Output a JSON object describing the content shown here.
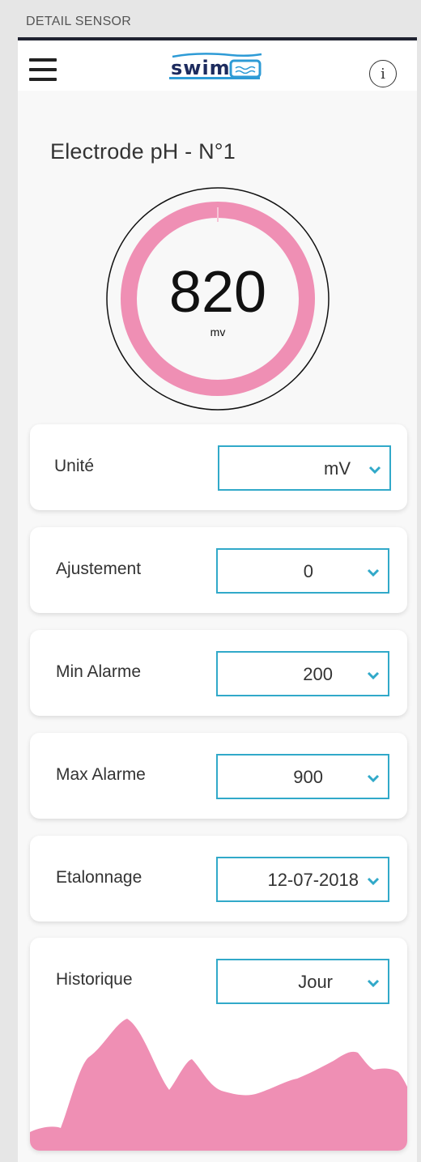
{
  "frame_title": "DETAIL SENSOR",
  "app": {
    "brand_text": "swim",
    "info_glyph": "i"
  },
  "sensor": {
    "title": "Electrode pH - N°1",
    "value": "820",
    "unit": "mv",
    "ring_color": "#ef8fb4"
  },
  "settings": [
    {
      "label": "Unité",
      "value": "mV"
    },
    {
      "label": "Ajustement",
      "value": "0"
    },
    {
      "label": "Min Alarme",
      "value": "200"
    },
    {
      "label": "Max Alarme",
      "value": "900"
    },
    {
      "label": "Etalonnage",
      "value": "12-07-2018"
    },
    {
      "label": "Historique",
      "value": "Jour"
    }
  ],
  "colors": {
    "accent": "#31a9c9",
    "chart_fill": "#ef8fb4"
  },
  "icons": {
    "menu": "hamburger-icon",
    "info": "info-icon",
    "dropdown": "chevron-down-icon"
  }
}
